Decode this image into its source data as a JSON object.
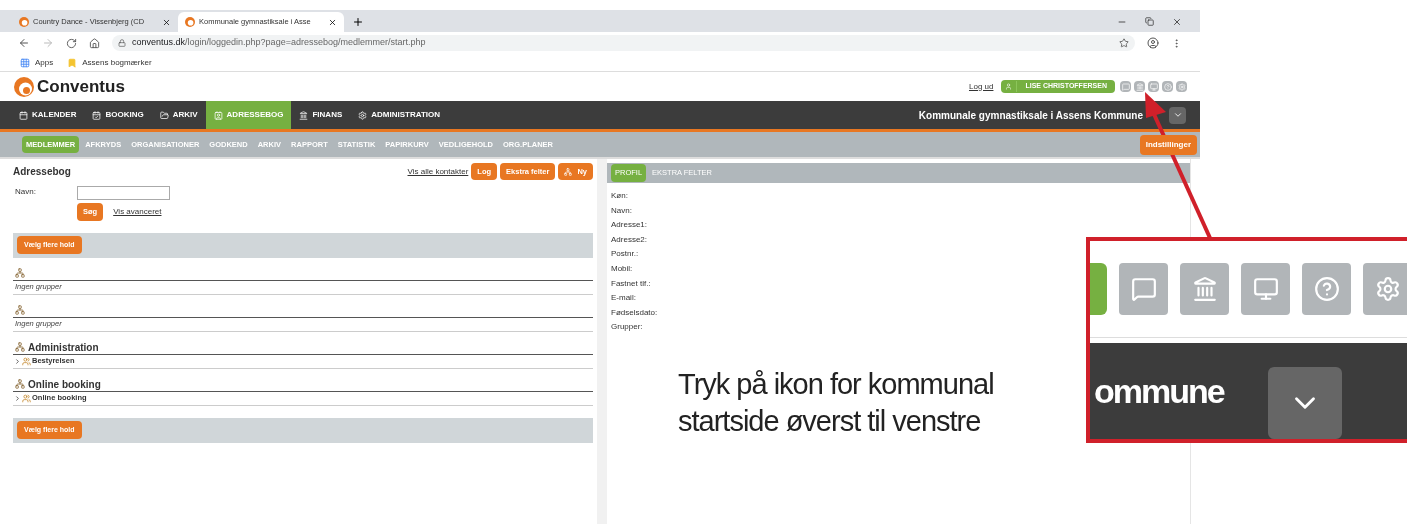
{
  "browser": {
    "tabs": [
      {
        "title": "Country Dance - Vissenbjerg (CD",
        "selected": false
      },
      {
        "title": "Kommunale gymnastiksale i Asse",
        "selected": true
      }
    ],
    "url_host": "conventus.dk",
    "url_path": "/login/loggedin.php?page=adressebog/medlemmer/start.php",
    "bookmarks": [
      "Apps",
      "Assens bogmærker"
    ]
  },
  "app": {
    "logo": "Conventus",
    "logout": "Log ud",
    "user": "LISE CHRISTOFFERSEN",
    "nav": [
      {
        "label": "KALENDER",
        "selected": false
      },
      {
        "label": "BOOKING",
        "selected": false
      },
      {
        "label": "ARKIV",
        "selected": false
      },
      {
        "label": "ADRESSEBOG",
        "selected": true
      },
      {
        "label": "FINANS",
        "selected": false
      },
      {
        "label": "ADMINISTRATION",
        "selected": false
      }
    ],
    "organisation": "Kommunale gymnastiksale i Assens Kommune",
    "subnav": [
      {
        "label": "MEDLEMMER",
        "selected": true
      },
      {
        "label": "AFKRYDS",
        "selected": false
      },
      {
        "label": "ORGANISATIONER",
        "selected": false
      },
      {
        "label": "GODKEND",
        "selected": false
      },
      {
        "label": "ARKIV",
        "selected": false
      },
      {
        "label": "RAPPORT",
        "selected": false
      },
      {
        "label": "STATISTIK",
        "selected": false
      },
      {
        "label": "PAPIRKURV",
        "selected": false
      },
      {
        "label": "VEDLIGEHOLD",
        "selected": false
      },
      {
        "label": "ORG.PLANER",
        "selected": false
      }
    ],
    "settings_button": "Indstillinger"
  },
  "addressbook": {
    "title": "Adressebog",
    "show_all_link": "Vis alle kontakter",
    "buttons": [
      "Log",
      "Ekstra felter"
    ],
    "new_button": "Ny",
    "name_label": "Navn:",
    "search_button": "Søg",
    "advanced_link": "Vis avanceret",
    "choose_button_top": "Vælg flere hold",
    "choose_button_bottom": "Vælg flere hold",
    "groups": [
      {
        "empty_text": "Ingen grupper"
      },
      {
        "empty_text": "Ingen grupper"
      },
      {
        "title": "Administration",
        "items": [
          "Bestyrelsen"
        ]
      },
      {
        "title": "Online booking",
        "items": [
          "Online booking"
        ]
      }
    ]
  },
  "profile": {
    "tabs": [
      {
        "label": "PROFIL",
        "selected": true
      },
      {
        "label": "EKSTRA FELTER",
        "selected": false
      }
    ],
    "fields": [
      "Køn:",
      "Navn:",
      "Adresse1:",
      "Adresse2:",
      "Postnr.:",
      "Mobil:",
      "Fastnet tlf.:",
      "E-mail:",
      "Fødselsdato:",
      "Grupper:"
    ]
  },
  "annotation": {
    "caption": "Tryk på ikon for kommunal startside øverst til venstre",
    "inset_text": "ommune"
  }
}
